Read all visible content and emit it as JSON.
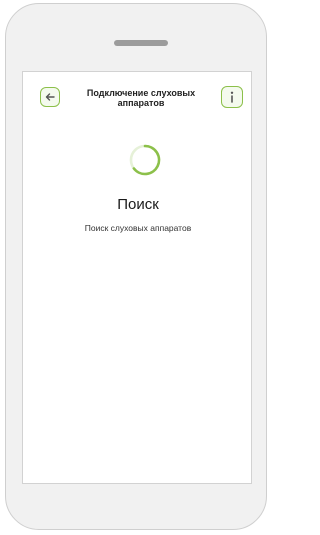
{
  "header": {
    "title": "Подключение слуховых аппаратов",
    "back_icon": "arrow-left-icon",
    "info_icon": "info-icon"
  },
  "status": {
    "heading": "Поиск",
    "subtitle": "Поиск слуховых аппаратов"
  },
  "spinner": {
    "icon": "loading-spinner-icon"
  },
  "colors": {
    "accent": "#8cc04a",
    "accent_light": "#f4faee",
    "frame": "#f1f1f1",
    "text": "#1a1a1a"
  }
}
